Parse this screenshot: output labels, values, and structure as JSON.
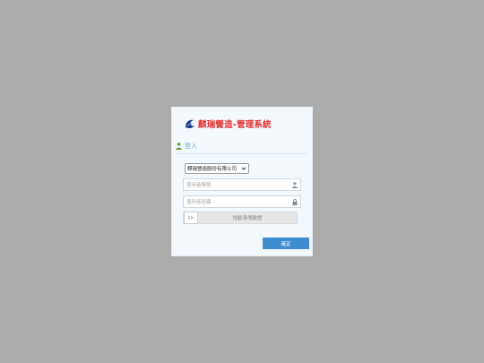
{
  "brand": {
    "title": "麒瑞營造-管理系統"
  },
  "login": {
    "section_label": "登入",
    "company_select": {
      "value": "麒瑞營造股份有限公司"
    },
    "username": {
      "placeholder": "使用者帳號"
    },
    "password": {
      "placeholder": "使用者密碼"
    },
    "slider": {
      "handle_label": ">>",
      "hint": "拖動滑塊驗證"
    },
    "confirm_label": "確定"
  },
  "colors": {
    "page_background": "#ababab",
    "dialog_background": "#f3f8fd",
    "brand_title": "#e0312f",
    "section_label": "#72a8c9",
    "user_icon": "#5aa23f",
    "confirm_button": "#3f8ccf"
  },
  "icons": {
    "logo": "company-logo",
    "section": "user-icon",
    "username_field": "person-icon",
    "password_field": "lock-icon",
    "select": "chevron-down-icon",
    "slider_handle": "double-chevron-right-icon"
  }
}
